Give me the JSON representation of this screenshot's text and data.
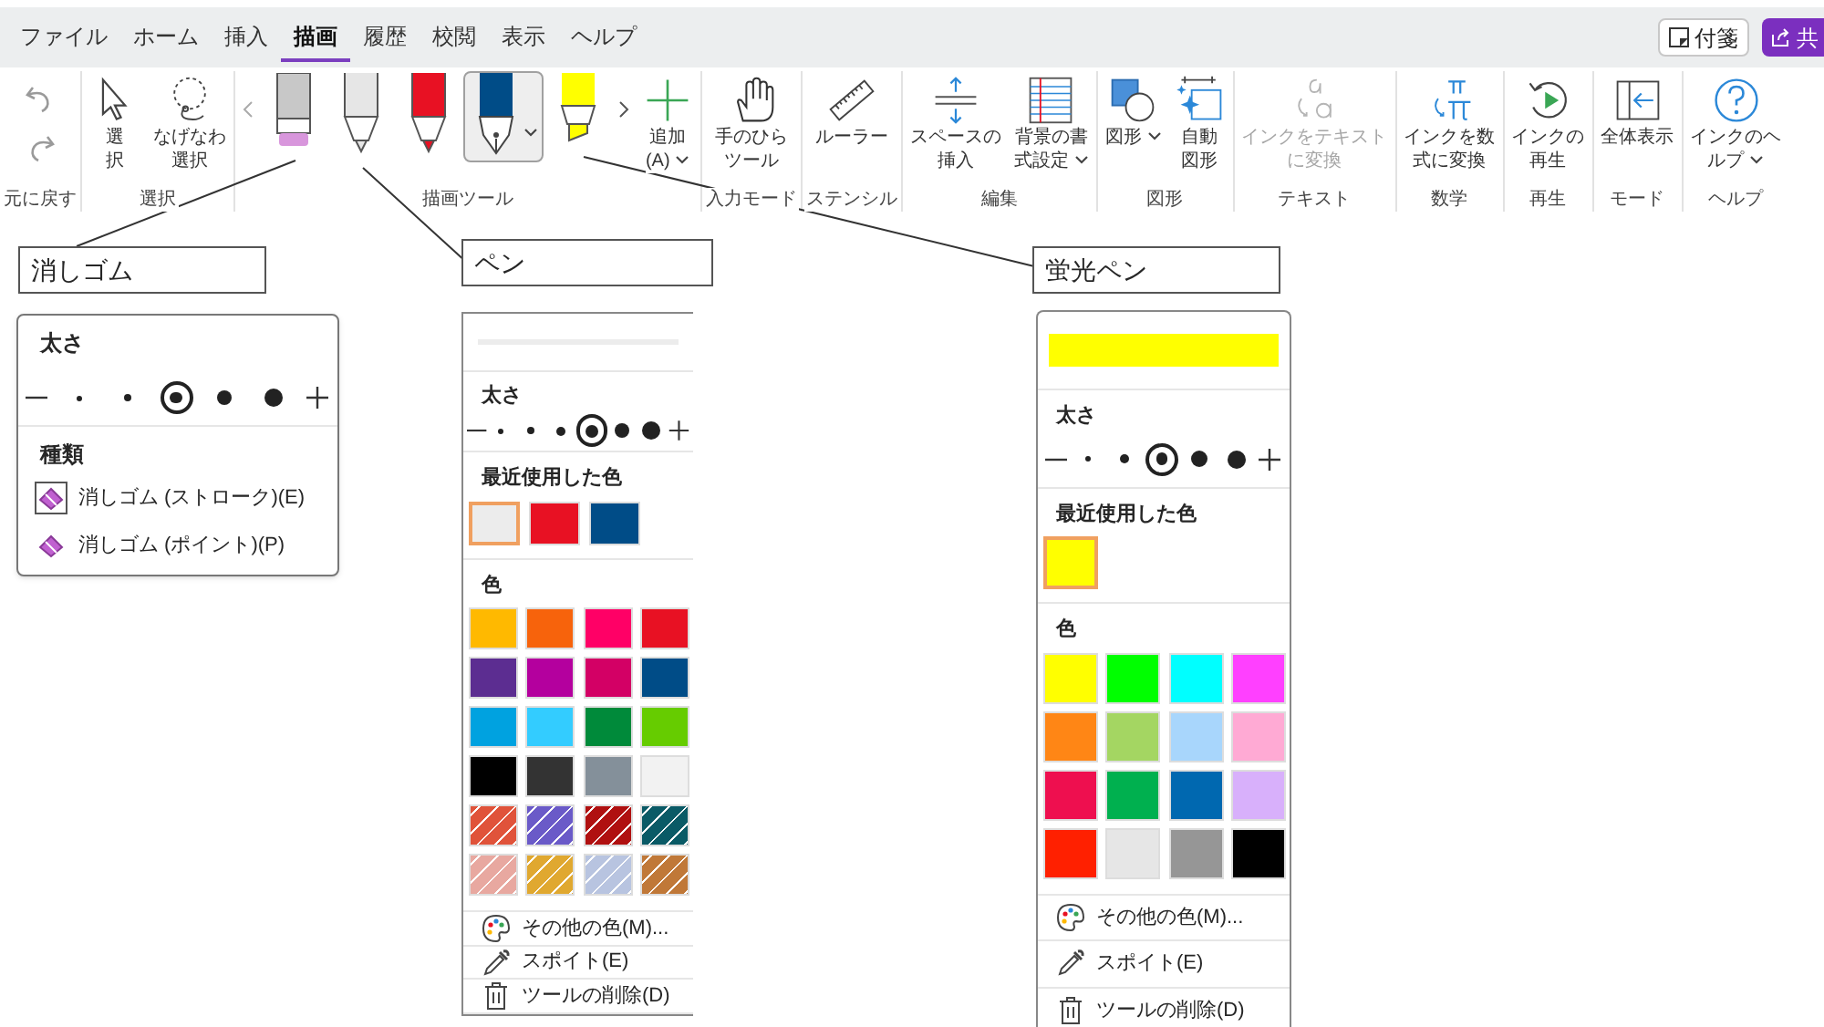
{
  "tabs": [
    {
      "label": "ファイル",
      "selected": false
    },
    {
      "label": "ホーム",
      "selected": false
    },
    {
      "label": "挿入",
      "selected": false
    },
    {
      "label": "描画",
      "selected": true
    },
    {
      "label": "履歴",
      "selected": false
    },
    {
      "label": "校閲",
      "selected": false
    },
    {
      "label": "表示",
      "selected": false
    },
    {
      "label": "ヘルプ",
      "selected": false
    }
  ],
  "top_buttons": [
    {
      "kind": "note",
      "label": "付箋"
    },
    {
      "kind": "share",
      "label": "共"
    }
  ],
  "ribbon": {
    "groups": [
      {
        "kind": "stack",
        "label": "元に戻す",
        "items": [
          {
            "kind": "undo"
          },
          {
            "kind": "redo"
          }
        ]
      },
      {
        "kind": "row",
        "label": "選択",
        "items": [
          {
            "kind": "select",
            "lines": [
              "選",
              "択"
            ],
            "disabled": false,
            "dropdown": false
          },
          {
            "kind": "lasso",
            "lines": [
              "なげなわ",
              "選択"
            ],
            "disabled": false,
            "dropdown": false
          }
        ]
      },
      {
        "kind": "gallery",
        "label": "描画ツール",
        "pens": [
          {
            "kind": "eraser",
            "color": "#d896dc",
            "selected": false
          },
          {
            "kind": "ballpoint",
            "color": "#e6e6e6",
            "selected": false
          },
          {
            "kind": "ballpoint",
            "color": "#e81123",
            "selected": false
          },
          {
            "kind": "fountain",
            "color": "#004c87",
            "selected": true
          },
          {
            "kind": "highlighter",
            "color": "#ffff00",
            "selected": false
          }
        ],
        "items": [
          {
            "kind": "add",
            "lines": [
              "追加",
              "(A)"
            ],
            "disabled": false,
            "dropdown": true
          }
        ]
      },
      {
        "kind": "row",
        "label": "入力モード",
        "items": [
          {
            "kind": "hand",
            "lines": [
              "手のひら",
              "ツール"
            ],
            "disabled": false,
            "dropdown": false
          }
        ]
      },
      {
        "kind": "row",
        "label": "ステンシル",
        "items": [
          {
            "kind": "ruler",
            "lines": [
              "ルーラー"
            ],
            "disabled": false,
            "dropdown": false
          }
        ]
      },
      {
        "kind": "row",
        "label": "編集",
        "items": [
          {
            "kind": "space",
            "lines": [
              "スペースの",
              "挿入"
            ],
            "disabled": false,
            "dropdown": false
          },
          {
            "kind": "background",
            "lines": [
              "背景の書",
              "式設定"
            ],
            "disabled": false,
            "dropdown": true
          }
        ]
      },
      {
        "kind": "row",
        "label": "図形",
        "items": [
          {
            "kind": "shapes",
            "lines": [
              "図形"
            ],
            "disabled": false,
            "dropdown": true
          },
          {
            "kind": "autoshapes",
            "lines": [
              "自動",
              "図形"
            ],
            "disabled": false,
            "dropdown": false
          }
        ]
      },
      {
        "kind": "row",
        "label": "テキスト",
        "items": [
          {
            "kind": "inktext",
            "lines": [
              "インクをテキスト",
              "に変換"
            ],
            "disabled": true,
            "dropdown": false
          }
        ]
      },
      {
        "kind": "row",
        "label": "数学",
        "items": [
          {
            "kind": "inkmath",
            "lines": [
              "インクを数",
              "式に変換"
            ],
            "disabled": false,
            "dropdown": false
          }
        ]
      },
      {
        "kind": "row",
        "label": "再生",
        "items": [
          {
            "kind": "replay",
            "lines": [
              "インクの",
              "再生"
            ],
            "disabled": false,
            "dropdown": false
          }
        ]
      },
      {
        "kind": "row",
        "label": "モード",
        "items": [
          {
            "kind": "fullview",
            "lines": [
              "全体表示"
            ],
            "disabled": false,
            "dropdown": false
          }
        ]
      },
      {
        "kind": "row",
        "label": "ヘルプ",
        "items": [
          {
            "kind": "help",
            "lines": [
              "インクのヘ",
              "ルプ"
            ],
            "disabled": false,
            "dropdown": true
          }
        ]
      }
    ]
  },
  "callouts": [
    {
      "label": "消しゴム"
    },
    {
      "label": "ペン"
    },
    {
      "label": "蛍光ペン"
    }
  ],
  "eraser_menu": {
    "thickness_heading": "太さ",
    "sizes": [
      {
        "selected": false
      },
      {
        "selected": false
      },
      {
        "selected": true
      },
      {
        "selected": false
      },
      {
        "selected": false
      }
    ],
    "type_heading": "種類",
    "types": [
      {
        "label": "消しゴム (ストローク)(E)",
        "selected": true
      },
      {
        "label": "消しゴム (ポイント)(P)",
        "selected": false
      }
    ]
  },
  "pen_menu": {
    "thickness_heading": "太さ",
    "sizes": [
      {
        "selected": false
      },
      {
        "selected": false
      },
      {
        "selected": false
      },
      {
        "selected": true
      },
      {
        "selected": false
      },
      {
        "selected": false
      }
    ],
    "recent_heading": "最近使用した色",
    "recent_colors": [
      {
        "color": "#ececec",
        "selected": true
      },
      {
        "color": "#e81123",
        "selected": false
      },
      {
        "color": "#004c87",
        "selected": false
      }
    ],
    "colors_heading": "色",
    "colors": [
      {
        "kind": "solid",
        "color": "#ffb900"
      },
      {
        "kind": "solid",
        "color": "#f7630c"
      },
      {
        "kind": "solid",
        "color": "#ff0066"
      },
      {
        "kind": "solid",
        "color": "#e81123"
      },
      {
        "kind": "solid",
        "color": "#5c2d91"
      },
      {
        "kind": "solid",
        "color": "#b4009e"
      },
      {
        "kind": "solid",
        "color": "#d30065"
      },
      {
        "kind": "solid",
        "color": "#004c87"
      },
      {
        "kind": "solid",
        "color": "#00a2e0"
      },
      {
        "kind": "solid",
        "color": "#33ccff"
      },
      {
        "kind": "solid",
        "color": "#008a3a"
      },
      {
        "kind": "solid",
        "color": "#66cc00"
      },
      {
        "kind": "solid",
        "color": "#000000"
      },
      {
        "kind": "solid",
        "color": "#333333"
      },
      {
        "kind": "solid",
        "color": "#84909a"
      },
      {
        "kind": "solid",
        "color": "#f2f2f2"
      },
      {
        "kind": "texture",
        "color": "#e0533a"
      },
      {
        "kind": "texture",
        "color": "#6a5ac8"
      },
      {
        "kind": "texture",
        "color": "#b01010"
      },
      {
        "kind": "texture",
        "color": "#0a5a66"
      },
      {
        "kind": "texture",
        "color": "#e8a8a0"
      },
      {
        "kind": "texture",
        "color": "#e0a830"
      },
      {
        "kind": "texture",
        "color": "#b8c4e0"
      },
      {
        "kind": "texture",
        "color": "#c07838"
      }
    ],
    "actions": [
      {
        "kind": "palette",
        "label": "その他の色(M)..."
      },
      {
        "kind": "eyedropper",
        "label": "スポイト(E)"
      },
      {
        "kind": "delete",
        "label": "ツールの削除(D)"
      }
    ]
  },
  "highlighter_menu": {
    "thickness_heading": "太さ",
    "sizes": [
      {
        "selected": false
      },
      {
        "selected": false
      },
      {
        "selected": true
      },
      {
        "selected": false
      },
      {
        "selected": false
      }
    ],
    "recent_heading": "最近使用した色",
    "recent_colors": [
      {
        "color": "#ffff00",
        "selected": true
      }
    ],
    "colors_heading": "色",
    "colors": [
      {
        "kind": "solid",
        "color": "#ffff00"
      },
      {
        "kind": "solid",
        "color": "#00ff00"
      },
      {
        "kind": "solid",
        "color": "#00ffff"
      },
      {
        "kind": "solid",
        "color": "#ff40ff"
      },
      {
        "kind": "solid",
        "color": "#ff8615"
      },
      {
        "kind": "solid",
        "color": "#a4d662"
      },
      {
        "kind": "solid",
        "color": "#a8d6fc"
      },
      {
        "kind": "solid",
        "color": "#ffaad4"
      },
      {
        "kind": "solid",
        "color": "#ee0f4f"
      },
      {
        "kind": "solid",
        "color": "#00b04f"
      },
      {
        "kind": "solid",
        "color": "#0068b0"
      },
      {
        "kind": "solid",
        "color": "#d8b0fb"
      },
      {
        "kind": "solid",
        "color": "#ff2000"
      },
      {
        "kind": "solid",
        "color": "#e6e6e6"
      },
      {
        "kind": "solid",
        "color": "#969696"
      },
      {
        "kind": "solid",
        "color": "#000000"
      }
    ],
    "actions": [
      {
        "kind": "palette",
        "label": "その他の色(M)..."
      },
      {
        "kind": "eyedropper",
        "label": "スポイト(E)"
      },
      {
        "kind": "delete",
        "label": "ツールの削除(D)"
      }
    ]
  }
}
